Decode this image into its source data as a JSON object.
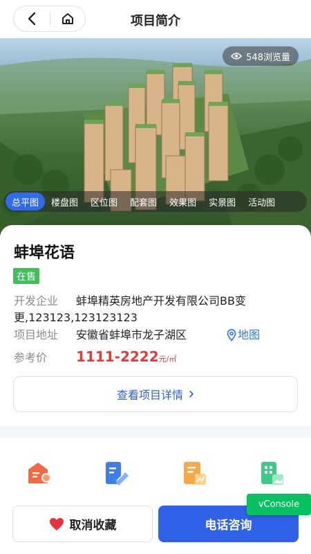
{
  "nav": {
    "title": "项目简介"
  },
  "hero": {
    "views_label": "548浏览量",
    "tabs": [
      "总平图",
      "楼盘图",
      "区位图",
      "配套图",
      "效果图",
      "实景图",
      "活动图"
    ],
    "active_tab_index": 0
  },
  "project": {
    "name": "蚌埠花语",
    "status": "在售",
    "developer_label": "开发企业",
    "developer_value": "蚌埠精英房地产开发有限公司BB变更,123123,123123123",
    "address_label": "项目地址",
    "address_value": "安徽省蚌埠市龙子湖区",
    "map_label": "地图",
    "price_label": "参考价",
    "price_value": "1111-2222",
    "price_unit": "元/㎡",
    "detail_button": "查看项目详情"
  },
  "bottom": {
    "fav_label": "取消收藏",
    "call_label": "电话咨询"
  },
  "vconsole_label": "vConsole",
  "colors": {
    "primary": "#2f62e8",
    "status_green": "#3fbf5a",
    "price_red": "#e33a3a",
    "link_blue": "#2a7de1"
  }
}
